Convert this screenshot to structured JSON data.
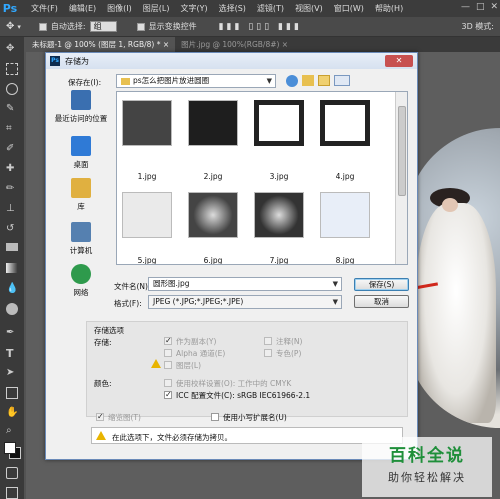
{
  "app": {
    "logo": "Ps",
    "menu": [
      "文件(F)",
      "编辑(E)",
      "图像(I)",
      "图层(L)",
      "文字(Y)",
      "选择(S)",
      "滤镜(T)",
      "视图(V)",
      "窗口(W)",
      "帮助(H)"
    ],
    "window_controls": [
      "—",
      "□",
      "✕"
    ]
  },
  "options_bar": {
    "auto_select_label": "自动选择:",
    "auto_select_value": "组",
    "show_transform_label": "显示变换控件",
    "mode_label": "3D 模式:"
  },
  "tabs": [
    {
      "label": "未标题-1 @ 100% (图层 1, RGB/8) * ×",
      "active": true
    },
    {
      "label": "图片.jpg @ 100%(RGB/8#) ×",
      "active": false
    }
  ],
  "dialog": {
    "title": "存储为",
    "close": "✕",
    "save_in_label": "保存在(I):",
    "save_in_value": "ps怎么把图片放进圆圈",
    "places": [
      {
        "label": "最近访问的位置",
        "icon": "recent-places-icon",
        "color": "#3a6fb0"
      },
      {
        "label": "桌面",
        "icon": "desktop-icon",
        "color": "#2f7ad6"
      },
      {
        "label": "库",
        "icon": "libraries-icon",
        "color": "#e0b040"
      },
      {
        "label": "计算机",
        "icon": "computer-icon",
        "color": "#5580b0"
      },
      {
        "label": "网络",
        "icon": "network-icon",
        "color": "#2e9a4c"
      }
    ],
    "files": [
      "1.jpg",
      "2.jpg",
      "3.jpg",
      "4.jpg",
      "5.jpg",
      "6.jpg",
      "7.jpg",
      "8.jpg"
    ],
    "filename_label": "文件名(N):",
    "filename_value": "圆形图.jpg",
    "format_label": "格式(F):",
    "format_value": "JPEG (*.JPG;*.JPEG;*.JPE)",
    "save_button": "保存(S)",
    "cancel_button": "取消",
    "save_options_heading": "存储选项",
    "save_label": "存储:",
    "as_copy": "作为副本(Y)",
    "notes": "注释(N)",
    "alpha": "Alpha 通道(E)",
    "spot": "专色(P)",
    "layers": "图层(L)",
    "color_label": "颜色:",
    "proof_setup": "使用校样设置(O): 工作中的 CMYK",
    "icc_profile": "ICC 配置文件(C): sRGB IEC61966-2.1",
    "thumbnail": "缩览图(T)",
    "lowercase_ext": "使用小写扩展名(U)",
    "warning": "在此选项下，文件必须存储为拷贝。"
  },
  "watermark": {
    "main": "百科全说",
    "sub": "助你轻松解决"
  }
}
